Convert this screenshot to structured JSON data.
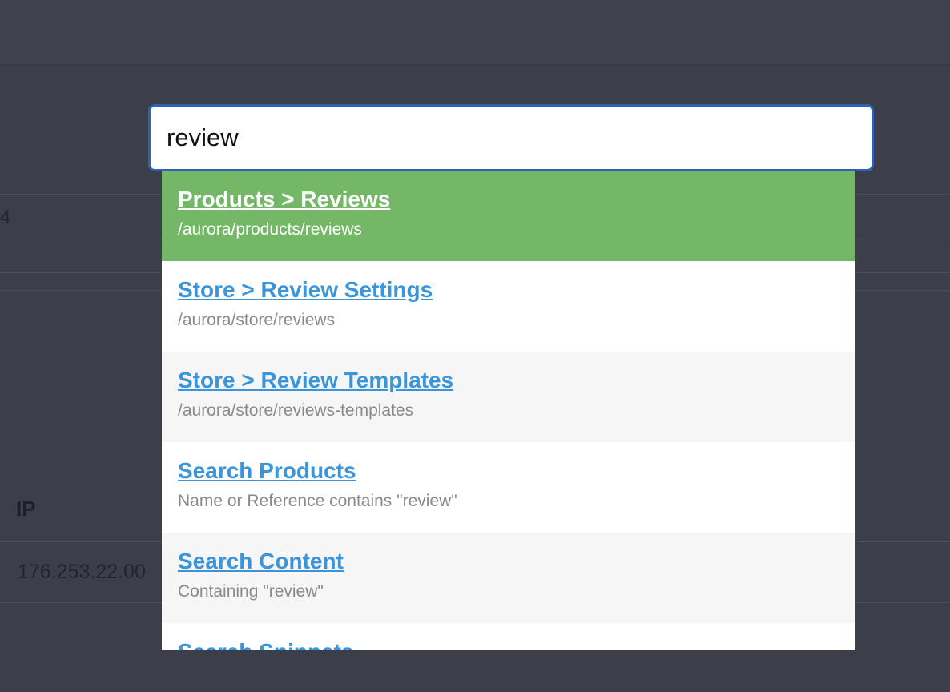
{
  "background": {
    "row_value": "4",
    "ip_header": "IP",
    "ip_value": "176.253.22.00"
  },
  "search": {
    "value": "review"
  },
  "results": [
    {
      "title": "Products > Reviews",
      "subtitle": "/aurora/products/reviews",
      "active": true
    },
    {
      "title": "Store > Review Settings",
      "subtitle": "/aurora/store/reviews"
    },
    {
      "title": "Store > Review Templates",
      "subtitle": "/aurora/store/reviews-templates"
    },
    {
      "title": "Search Products",
      "subtitle": "Name or Reference contains \"review\""
    },
    {
      "title": "Search Content",
      "subtitle": "Containing \"review\""
    },
    {
      "title": "Search Snippets",
      "subtitle": ""
    }
  ],
  "colors": {
    "active_row": "#74b766",
    "link": "#3a95db",
    "input_border": "#2f61b5",
    "overlay": "#3c3e4a"
  }
}
